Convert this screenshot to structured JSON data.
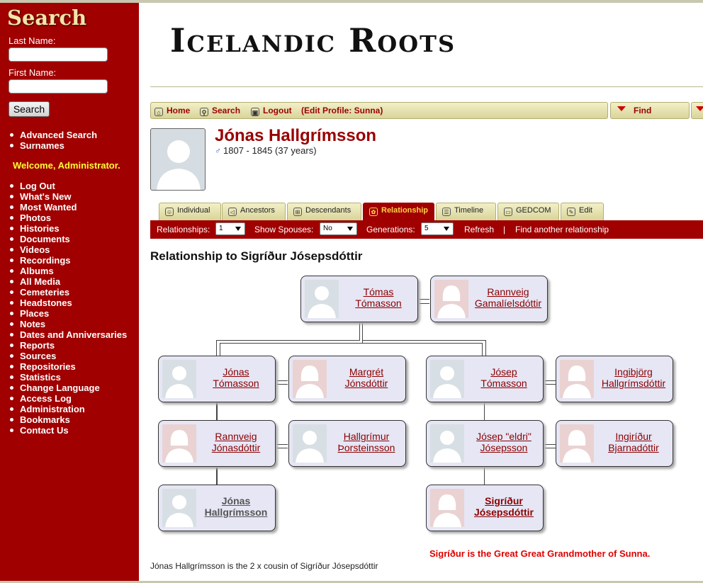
{
  "sidebar": {
    "title": "Search",
    "last_name_label": "Last Name:",
    "first_name_label": "First Name:",
    "search_button": "Search",
    "links_top": [
      "Advanced Search",
      "Surnames"
    ],
    "welcome": "Welcome, Administrator.",
    "links": [
      "Log Out",
      "What's New",
      "Most Wanted",
      "Photos",
      "Histories",
      "Documents",
      "Videos",
      "Recordings",
      "Albums",
      "All Media",
      "Cemeteries",
      "Headstones",
      "Places",
      "Notes",
      "Dates and Anniversaries",
      "Reports",
      "Sources",
      "Repositories",
      "Statistics",
      "Change Language",
      "Access Log",
      "Administration",
      "Bookmarks",
      "Contact Us"
    ]
  },
  "header": {
    "logo": "Icelandic Roots",
    "nav": {
      "home": "Home",
      "search": "Search",
      "logout": "Logout",
      "edit_profile": "(Edit Profile: Sunna)",
      "find": "Find"
    }
  },
  "person": {
    "name": "Jónas Hallgrímsson",
    "dates": "1807 - 1845  (37 years)"
  },
  "tabs": [
    {
      "label": "Individual",
      "icon": "person-icon"
    },
    {
      "label": "Ancestors",
      "icon": "ancestors-icon"
    },
    {
      "label": "Descendants",
      "icon": "descendants-icon"
    },
    {
      "label": "Relationship",
      "icon": "relationship-icon"
    },
    {
      "label": "Timeline",
      "icon": "timeline-icon"
    },
    {
      "label": "GEDCOM",
      "icon": "folder-icon"
    },
    {
      "label": "Edit",
      "icon": "edit-icon"
    }
  ],
  "options": {
    "relationships_label": "Relationships:",
    "relationships_value": "1",
    "spouses_label": "Show Spouses:",
    "spouses_value": "No",
    "generations_label": "Generations:",
    "generations_value": "5",
    "refresh": "Refresh",
    "separator": "|",
    "find_another": "Find another relationship"
  },
  "relationship_heading": "Relationship to Sigríður Jósepsdóttir",
  "tree": {
    "tomas": {
      "line1": "Tómas",
      "line2": "Tómasson"
    },
    "rannveig_g": {
      "line1": "Rannveig",
      "line2": "Gamalíelsdóttir"
    },
    "jonas_t": {
      "line1": "Jónas",
      "line2": "Tómasson"
    },
    "margret": {
      "line1": "Margrét",
      "line2": "Jónsdóttir"
    },
    "josep_t": {
      "line1": "Jósep",
      "line2": "Tómasson"
    },
    "ingibjorg": {
      "line1": "Ingibjörg",
      "line2": "Hallgrímsdóttir"
    },
    "rannveig_j": {
      "line1": "Rannveig",
      "line2": "Jónasdóttir"
    },
    "hallgrimur": {
      "line1": "Hallgrímur",
      "line2": "Þorsteinsson"
    },
    "josep_e": {
      "line1": "Jósep \"eldri\"",
      "line2": "Jósepsson"
    },
    "ingiridur": {
      "line1": "Ingiríður",
      "line2": "Bjarnadóttir"
    },
    "jonas_h": {
      "line1": "Jónas",
      "line2": "Hallgrímsson"
    },
    "sigridur": {
      "line1": "Sigríður",
      "line2": "Jósepsdóttir"
    }
  },
  "footer": {
    "relationship_text": "Jónas Hallgrímsson is the 2 x cousin of Sigríður Jósepsdóttir",
    "highlight": "Sigríður is the Great Great Grandmother of Sunna."
  }
}
